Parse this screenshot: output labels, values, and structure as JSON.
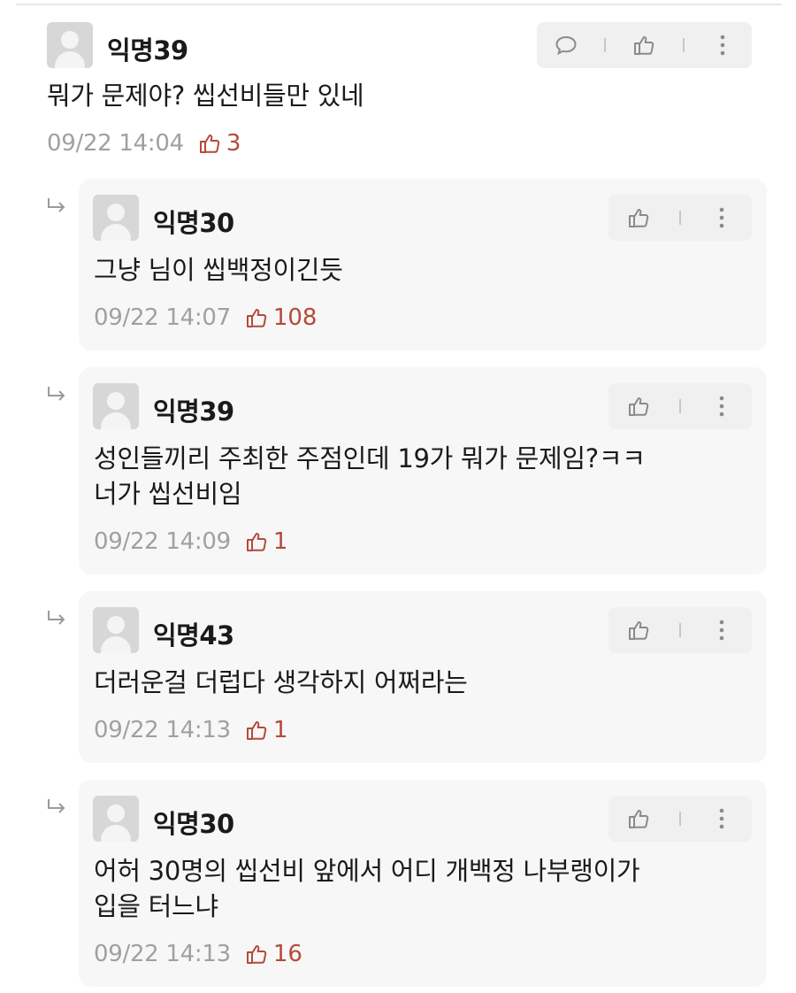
{
  "comments": [
    {
      "author": "익명39",
      "text": "뭐가 문제야? 씹선비들만 있네",
      "date": "09/22 14:04",
      "likes": "3"
    },
    {
      "author": "익명30",
      "text": "그냥 님이 씹백정이긴듯",
      "date": "09/22 14:07",
      "likes": "108"
    },
    {
      "author": "익명39",
      "text": "성인들끼리 주최한 주점인데 19가 뭐가 문제임?ㅋㅋ\n너가 씹선비임",
      "date": "09/22 14:09",
      "likes": "1"
    },
    {
      "author": "익명43",
      "text": "더러운걸 더럽다 생각하지 어쩌라는",
      "date": "09/22 14:13",
      "likes": "1"
    },
    {
      "author": "익명30",
      "text": "어허 30명의 씹선비 앞에서 어디 개백정 나부랭이가\n입을 터느냐",
      "date": "09/22 14:13",
      "likes": "16"
    }
  ],
  "icons": {
    "comment": "speech-bubble-icon",
    "like": "thumbs-up-icon",
    "more": "more-vertical-icon",
    "reply": "reply-arrow-icon"
  },
  "colors": {
    "like_count": "#b44a3a",
    "date": "#a0a0a0",
    "card_bg": "#f7f7f7",
    "action_bg": "#f0f0f0"
  }
}
